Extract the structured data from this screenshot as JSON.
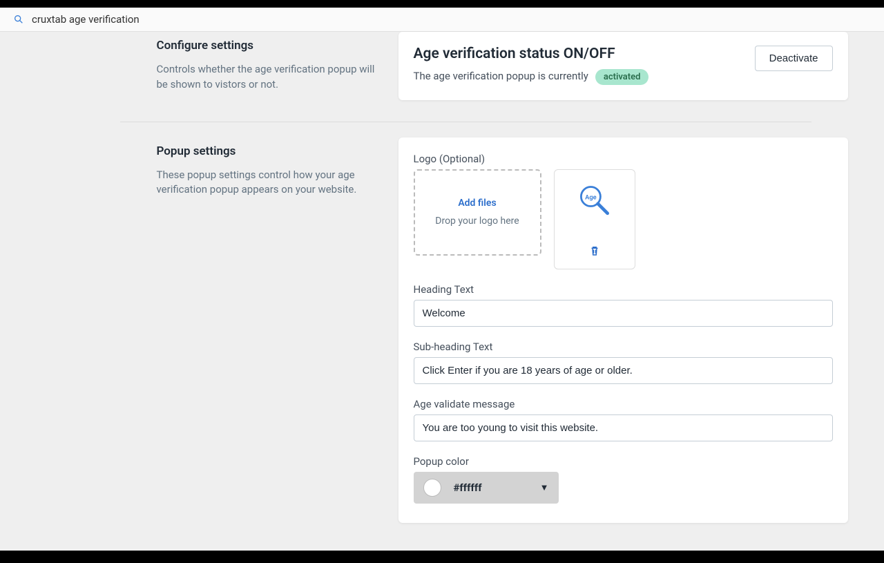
{
  "app": {
    "title": "cruxtab age verification"
  },
  "configure": {
    "heading": "Configure settings",
    "description": "Controls whether the age verification popup will be shown to vistors or not."
  },
  "status": {
    "heading": "Age verification status ON/OFF",
    "text_prefix": "The age verification popup is currently",
    "badge": "activated",
    "button": "Deactivate"
  },
  "popup": {
    "heading": "Popup settings",
    "description": "These popup settings control how your age verification popup appears on your website.",
    "logo_label": "Logo (Optional)",
    "add_files": "Add files",
    "drop_hint": "Drop your logo here",
    "preview_text": "Age",
    "heading_text_label": "Heading Text",
    "heading_text_value": "Welcome",
    "subheading_label": "Sub-heading Text",
    "subheading_value": "Click Enter if you are 18 years of age or older.",
    "age_validate_label": "Age validate message",
    "age_validate_value": "You are too young to visit this website.",
    "popup_color_label": "Popup color",
    "popup_color_value": "#ffffff"
  }
}
